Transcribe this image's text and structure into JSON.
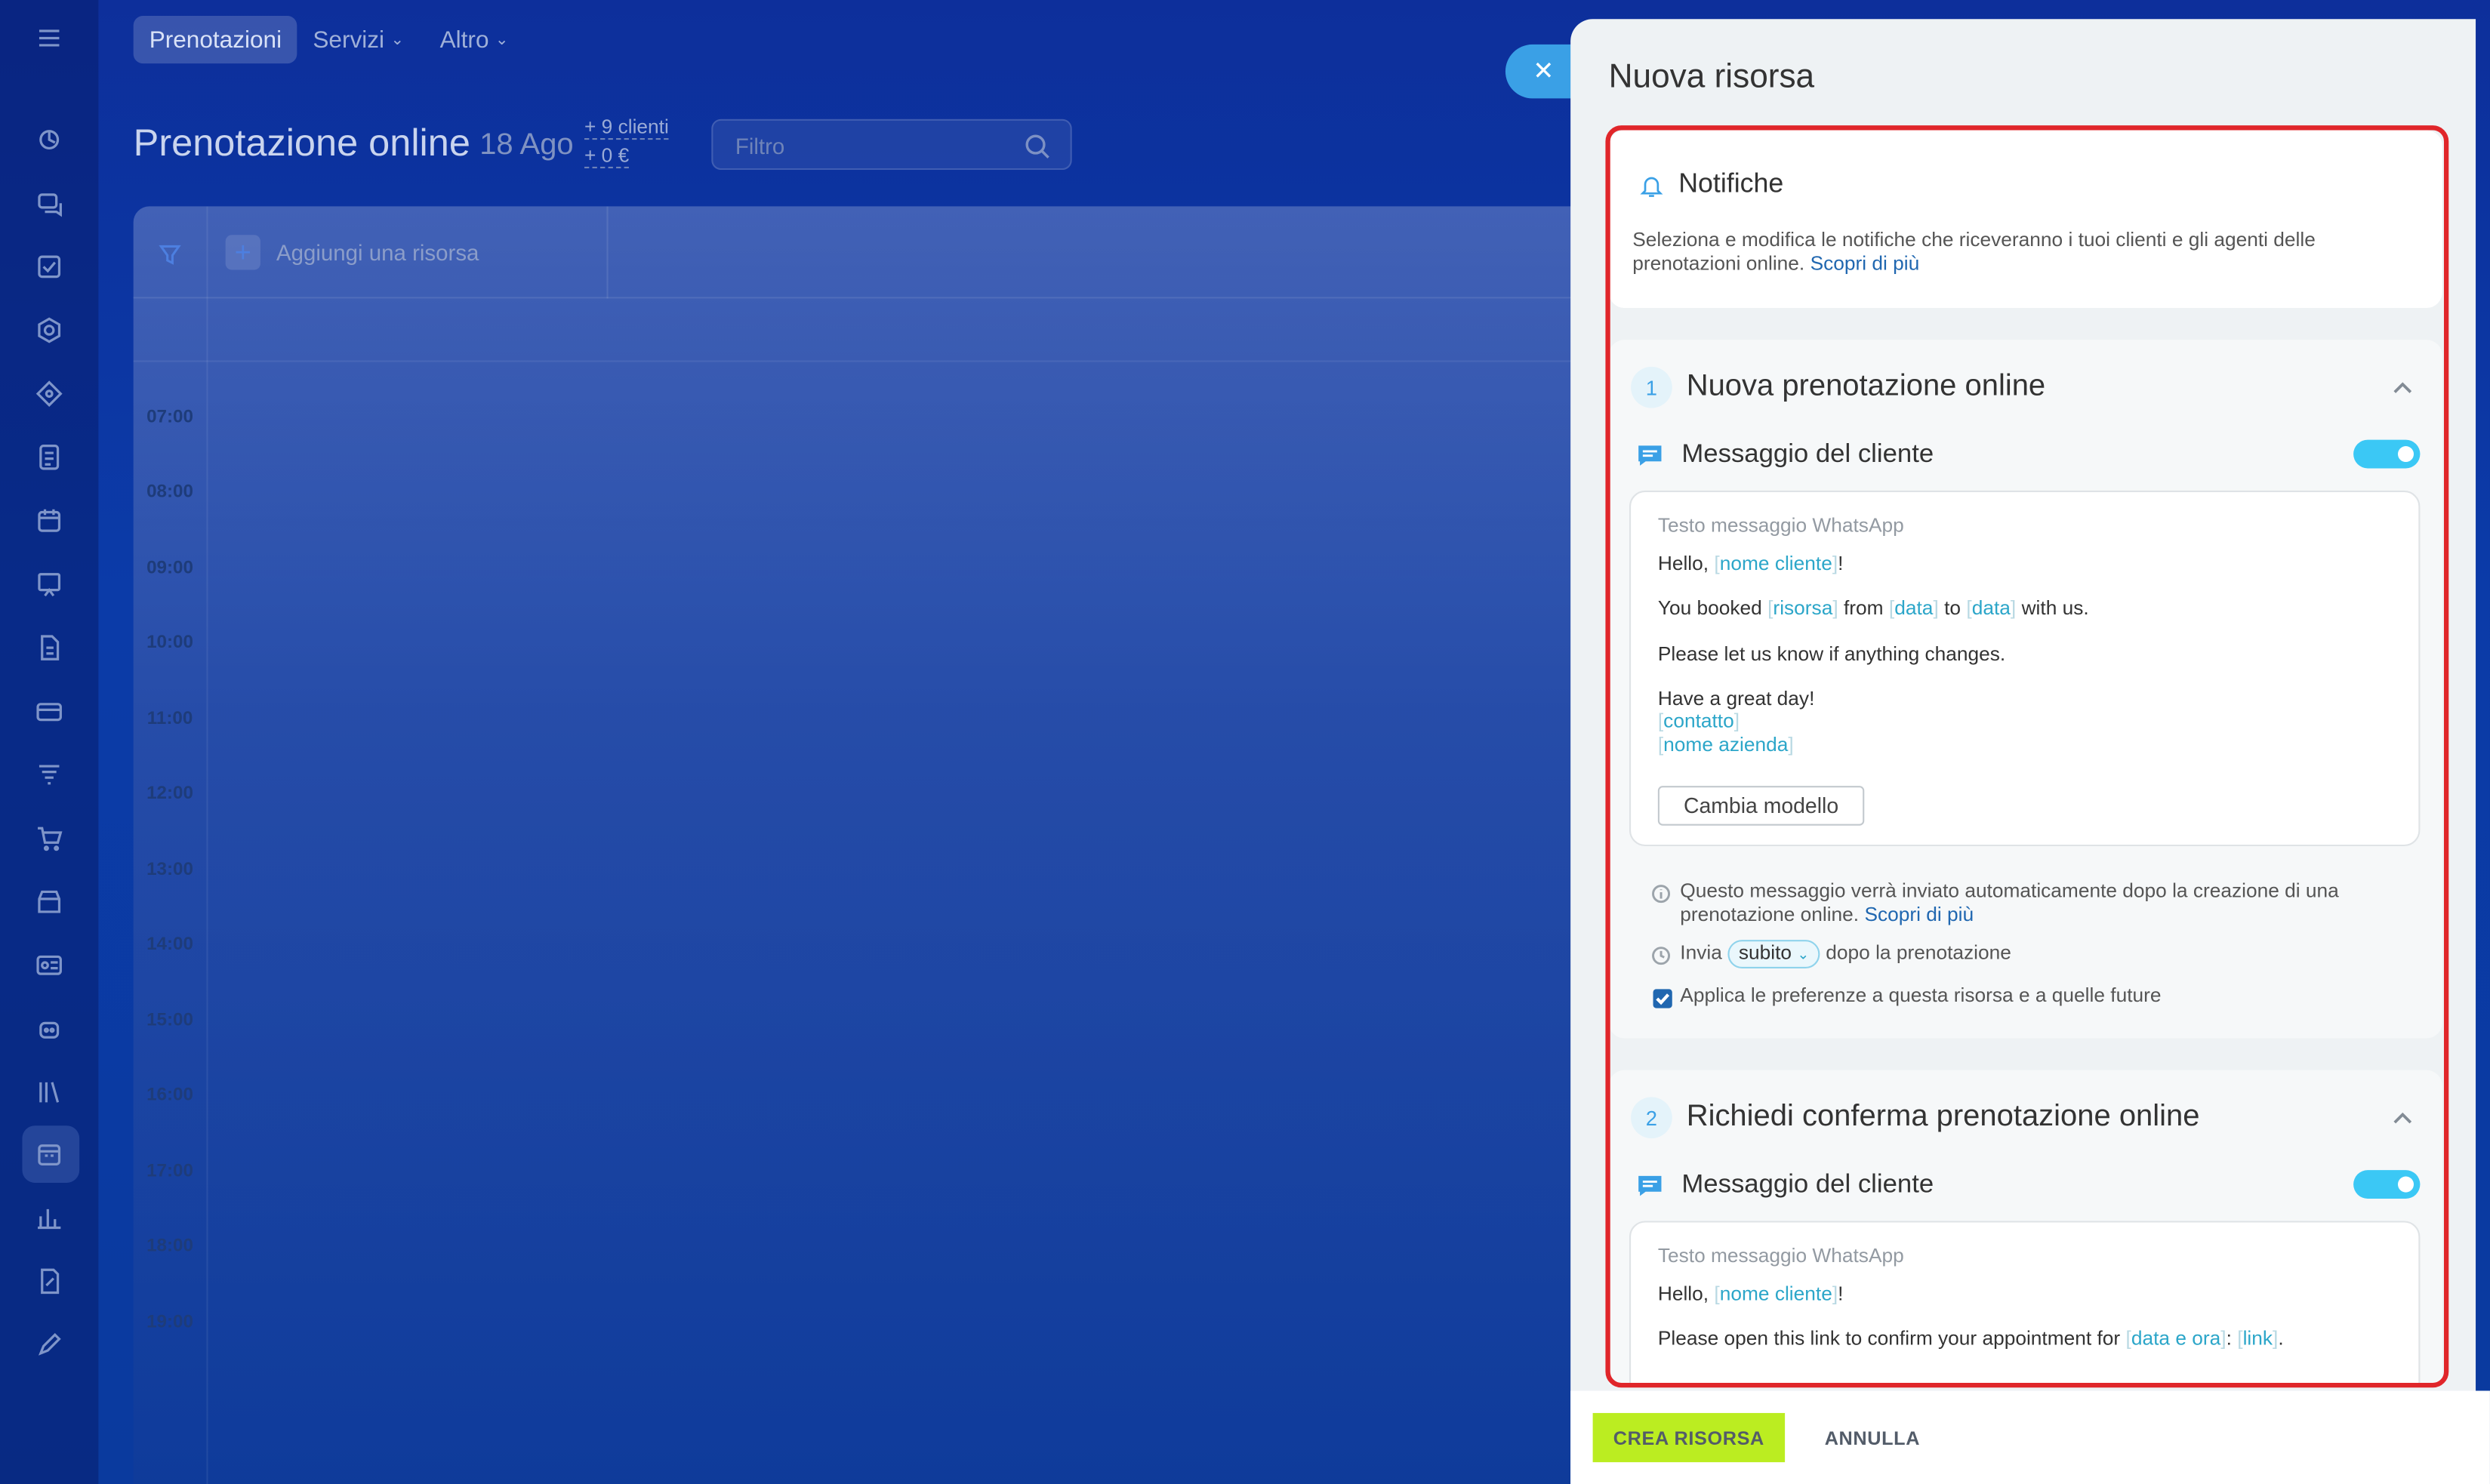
{
  "topbar": {
    "tabs": [
      {
        "label": "Prenotazioni"
      },
      {
        "label": "Servizi"
      },
      {
        "label": "Altro"
      }
    ]
  },
  "page": {
    "title": "Prenotazione online",
    "date": "18 Ago",
    "clients": "+ 9 clienti",
    "amount": "+ 0 €",
    "filter_placeholder": "Filtro"
  },
  "calendar": {
    "add_resource": "Aggiungi una risorsa",
    "hours": [
      "07:00",
      "08:00",
      "09:00",
      "10:00",
      "11:00",
      "12:00",
      "13:00",
      "14:00",
      "15:00",
      "16:00",
      "17:00",
      "18:00",
      "19:00"
    ]
  },
  "panel": {
    "title": "Nuova risorsa",
    "notifications": {
      "title": "Notifiche",
      "desc": "Seleziona e modifica le notifiche che riceveranno i tuoi clienti e gli agenti delle prenotazioni online.",
      "learn_more": "Scopri di più"
    },
    "section1": {
      "number": "1",
      "title": "Nuova prenotazione online",
      "message_label": "Messaggio del cliente",
      "bubble_header": "Testo messaggio WhatsApp",
      "hello": "Hello,",
      "tag_client": "nome cliente",
      "excl": "!",
      "booked_1": "You booked",
      "tag_resource": "risorsa",
      "booked_2": "from",
      "tag_date": "data",
      "booked_3": "to",
      "booked_4": "with us.",
      "line3": "Please let us know if anything changes.",
      "line4": "Have a great day!",
      "tag_contact": "contatto",
      "tag_company": "nome azienda",
      "change_template": "Cambia modello",
      "info": "Questo messaggio verrà inviato automaticamente dopo la creazione di una prenotazione online.",
      "info_link": "Scopri di più",
      "send_label": "Invia",
      "send_value": "subito",
      "send_suffix": "dopo la prenotazione",
      "apply_label": "Applica le preferenze a questa risorsa e a quelle future",
      "toggle_on": true,
      "apply_checked": true
    },
    "section2": {
      "number": "2",
      "title": "Richiedi conferma prenotazione online",
      "message_label": "Messaggio del cliente",
      "bubble_header": "Testo messaggio WhatsApp",
      "hello": "Hello,",
      "tag_client": "nome cliente",
      "excl": "!",
      "line2": "Please open this link to confirm your appointment for",
      "tag_datetime": "data e ora",
      "colon": ":",
      "tag_link": "link",
      "dot": ".",
      "toggle_on": true
    }
  },
  "footer": {
    "create": "CREA RISORSA",
    "cancel": "ANNULLA"
  },
  "colors": {
    "accent": "#3bc8f5",
    "create_button": "#bbed21",
    "highlight": "#e0262a",
    "background": "#0d2f9b"
  }
}
